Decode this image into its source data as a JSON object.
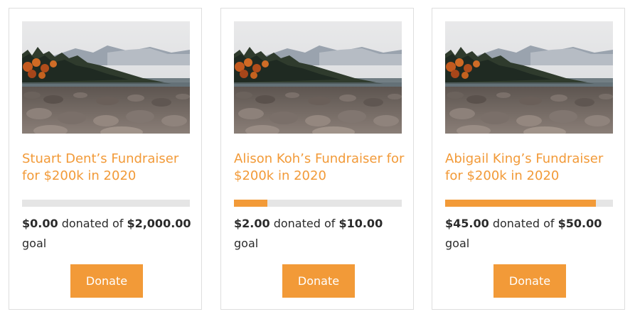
{
  "cards": [
    {
      "title": "Stuart Dent’s Fundraiser for $200k in 2020",
      "donated": "$0.00",
      "donated_of": " donated of ",
      "goal": "$2,000.00",
      "goal_suffix": " goal",
      "progress": 0,
      "donate_label": "Donate"
    },
    {
      "title": "Alison Koh’s Fundraiser for $200k in 2020",
      "donated": "$2.00",
      "donated_of": " donated of ",
      "goal": "$10.00",
      "goal_suffix": " goal",
      "progress": 0.2,
      "donate_label": "Donate"
    },
    {
      "title": "Abigail King’s Fundraiser for $200k in 2020",
      "donated": "$45.00",
      "donated_of": " donated of ",
      "goal": "$50.00",
      "goal_suffix": " goal",
      "progress": 0.9,
      "donate_label": "Donate"
    }
  ],
  "colors": {
    "accent": "#f29a38",
    "progress_track": "#e5e5e5",
    "card_border": "#dedede",
    "text": "#2b2b2b"
  },
  "image": {
    "icon": "lake-forest-photo"
  }
}
